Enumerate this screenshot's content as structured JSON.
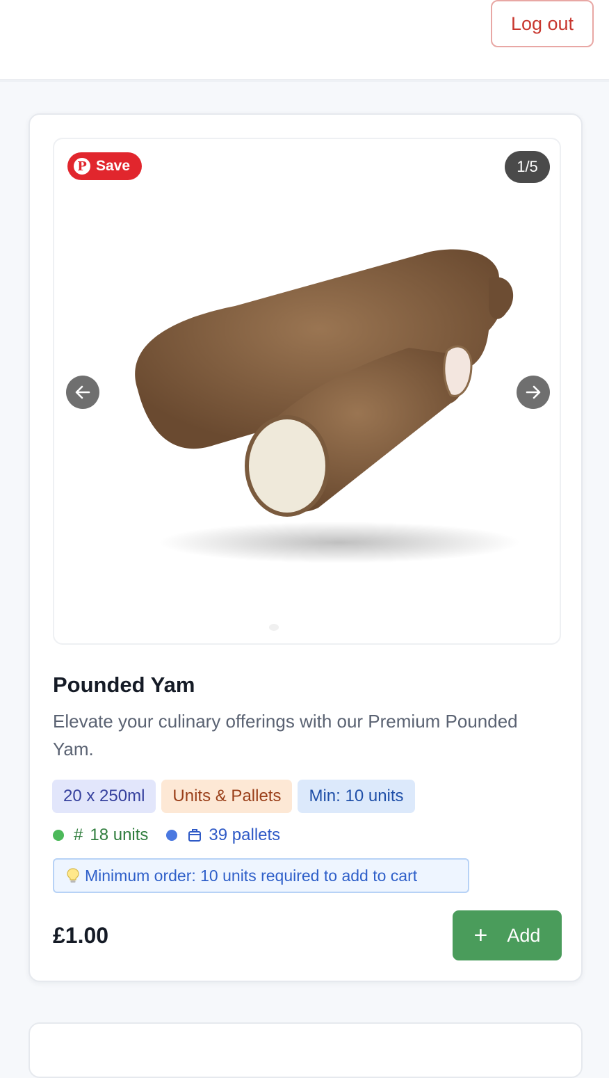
{
  "header": {
    "logout_label": "Log out"
  },
  "product": {
    "save_label": "Save",
    "image_counter": "1/5",
    "image_index": 1,
    "image_total": 5,
    "title": "Pounded Yam",
    "description": "Elevate your culinary offerings with our Premium Pounded Yam.",
    "tags": [
      "20 x 250ml",
      "Units & Pallets",
      "Min: 10 units"
    ],
    "stock": {
      "units": "18 units",
      "pallets": "39 pallets"
    },
    "notice": "Minimum order: 10 units required to add to cart",
    "price": "£1.00",
    "add_label": "Add"
  },
  "colors": {
    "brand_red": "#e1262d",
    "add_green": "#4a9c5b",
    "logout_red": "#c8372f"
  },
  "icons": [
    "pinterest-icon",
    "arrow-left-icon",
    "arrow-right-icon",
    "hash-icon",
    "box-icon",
    "lightbulb-icon",
    "plus-icon"
  ]
}
